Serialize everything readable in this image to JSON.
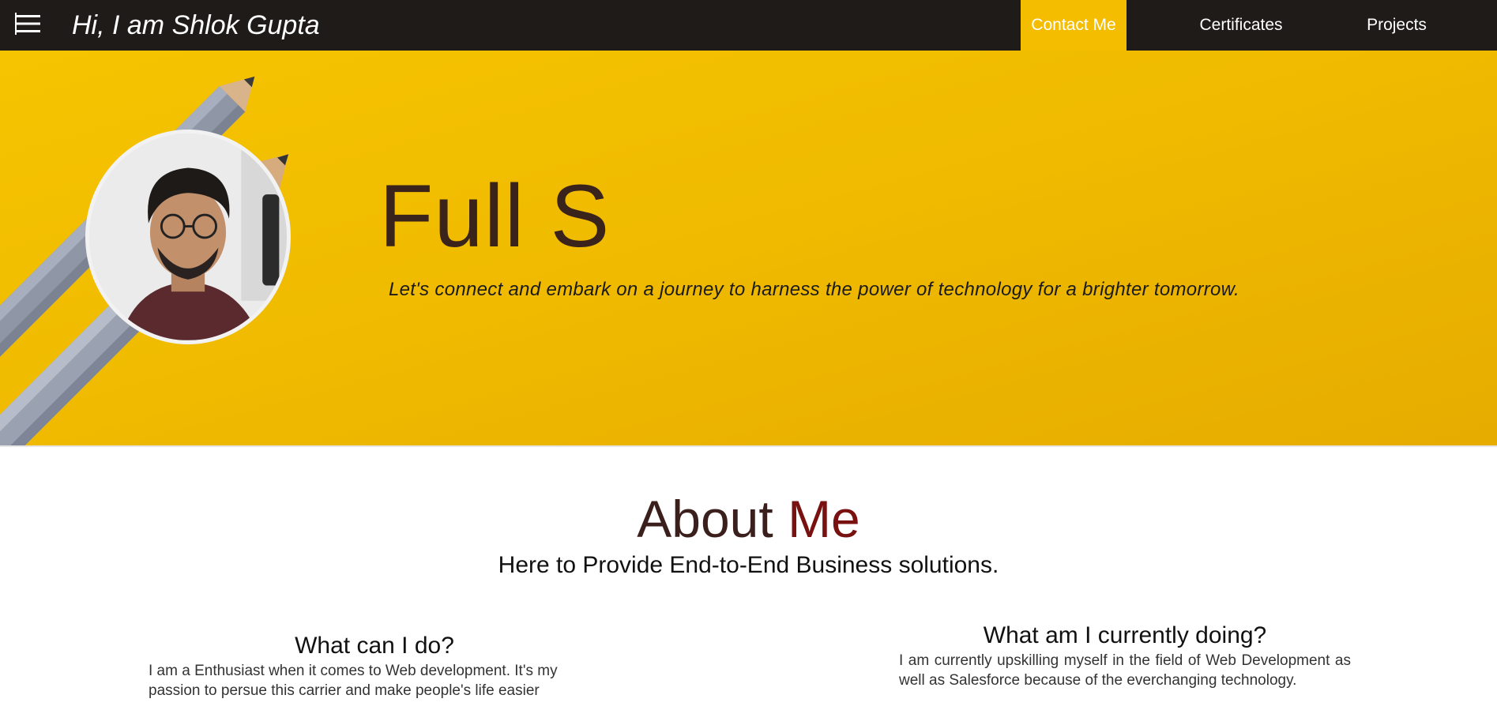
{
  "navbar": {
    "brand": "Hi, I am Shlok Gupta",
    "items": [
      {
        "label": "Contact Me",
        "active": true
      },
      {
        "label": "Certificates"
      },
      {
        "label": "Projects"
      }
    ],
    "menu_icon": "hamburger-menu-icon"
  },
  "hero": {
    "title": "Full S",
    "tagline": "Let's connect and embark on a journey to harness the power of technology for a brighter tomorrow.",
    "background_color": "#f4bd00"
  },
  "about": {
    "title_part1": "About ",
    "title_part2": "Me",
    "subtitle": "Here to Provide End-to-End Business solutions.",
    "columns": [
      {
        "heading": "What can I do?",
        "text": "I am a Enthusiast when it comes to Web development. It's my passion to persue this carrier and make people's life easier"
      },
      {
        "heading": "What am I currently doing?",
        "text": "I am currently upskilling myself in the field of Web Development as well as Salesforce because of the everchanging technology."
      }
    ]
  },
  "colors": {
    "navbar": "#1f1b18",
    "accent": "#f4bd00",
    "title_accent": "#7a1111"
  }
}
